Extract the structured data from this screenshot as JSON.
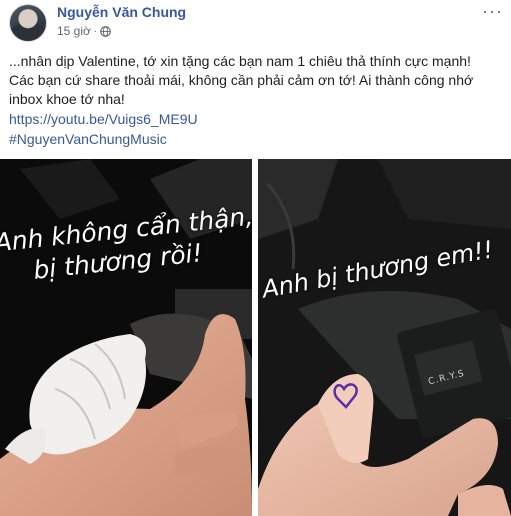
{
  "post": {
    "author": "Nguyễn Văn Chung",
    "time": "15 giờ",
    "dot": "·",
    "globe_icon": "globe-icon",
    "more_icon": "more-options-icon",
    "more_label": "···",
    "text_lines": [
      "...nhân dịp Valentine, tớ xin tặng các bạn nam 1 chiêu thả thính cực mạnh!",
      "Các bạn cứ share thoải mái, không cần phải cảm ơn tớ! Ai thành công nhớ",
      "inbox khoe tớ nha!"
    ],
    "link": "https://youtu.be/Vuigs6_ME9U",
    "hashtag": "#NguyenVanChungMusic"
  },
  "photos": {
    "left": {
      "caption_line1": "Anh không cẩn thận,",
      "caption_line2": "bị thương rồi!"
    },
    "right": {
      "caption": "Anh bị thương em!!",
      "box_label": "C.R.Y.S"
    }
  },
  "colors": {
    "link": "#385898",
    "meta": "#606770",
    "text": "#1c1e21"
  }
}
